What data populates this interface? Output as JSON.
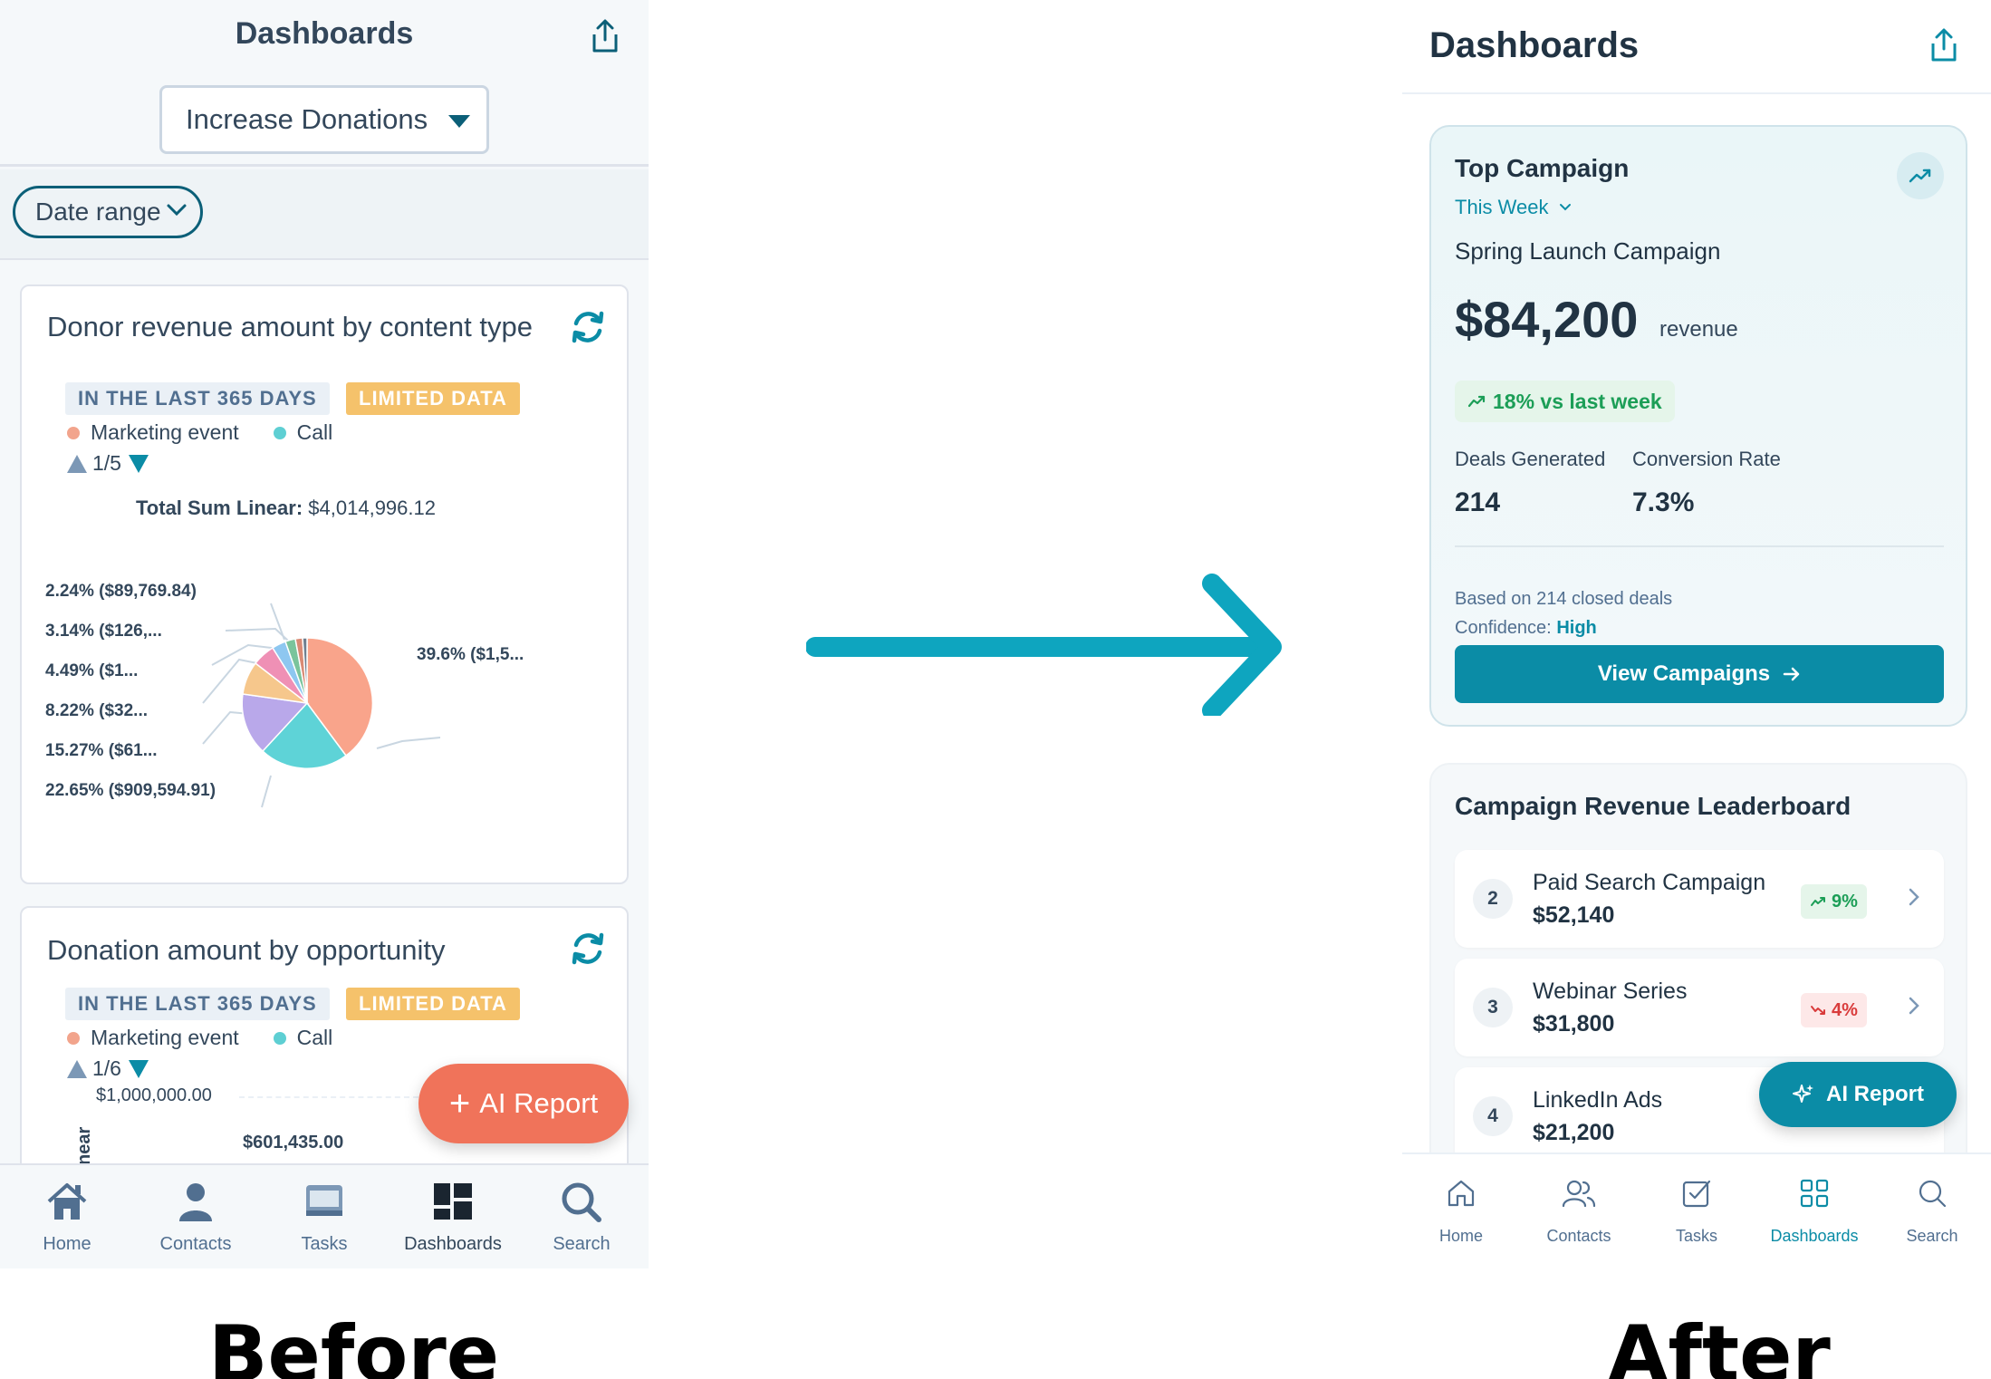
{
  "before": {
    "header": {
      "title": "Dashboards"
    },
    "dashboard_select": {
      "value": "Increase Donations"
    },
    "filters": {
      "date_range_label": "Date range"
    },
    "card1": {
      "title": "Donor revenue amount by content type",
      "tag_range": "IN THE LAST 365 DAYS",
      "tag_limited": "LIMITED DATA",
      "legend": [
        {
          "label": "Marketing event",
          "color": "#f2a48c"
        },
        {
          "label": "Call",
          "color": "#5ecfd3"
        }
      ],
      "pager": "1/5",
      "total_label": "Total Sum Linear:",
      "total_value": "$4,014,996.12",
      "pie_labels": [
        "2.24% ($89,769.84)",
        "3.14% ($126,...",
        "4.49% ($1...",
        "8.22% ($32...",
        "15.27% ($61...",
        "22.65% ($909,594.91)",
        "39.6% ($1,5..."
      ]
    },
    "card2": {
      "title": "Donation amount by opportunity",
      "tag_range": "IN THE LAST 365 DAYS",
      "tag_limited": "LIMITED DATA",
      "legend": [
        {
          "label": "Marketing event",
          "color": "#f2a48c"
        },
        {
          "label": "Call",
          "color": "#5ecfd3"
        }
      ],
      "pager": "1/6",
      "axis_top": "$1,000,000.00",
      "bar_label": "$601,435.00",
      "y_axis_fragment": "near"
    },
    "ai_button": {
      "label": "AI Report"
    },
    "nav": [
      {
        "label": "Home",
        "icon": "home-icon"
      },
      {
        "label": "Contacts",
        "icon": "contacts-icon"
      },
      {
        "label": "Tasks",
        "icon": "tasks-icon"
      },
      {
        "label": "Dashboards",
        "icon": "dashboards-icon"
      },
      {
        "label": "Search",
        "icon": "search-icon"
      }
    ]
  },
  "after": {
    "header": {
      "title": "Dashboards"
    },
    "top_campaign": {
      "title": "Top Campaign",
      "period": "This Week",
      "campaign_name": "Spring Launch Campaign",
      "revenue": "$84,200",
      "revenue_unit": "revenue",
      "delta": "18% vs last week",
      "stats": [
        {
          "label": "Deals Generated",
          "value": "214"
        },
        {
          "label": "Conversion Rate",
          "value": "7.3%"
        }
      ],
      "note": "Based on 214 closed deals",
      "confidence_label": "Confidence:",
      "confidence_value": "High",
      "cta": "View Campaigns"
    },
    "leaderboard": {
      "title": "Campaign Revenue Leaderboard",
      "rows": [
        {
          "rank": "2",
          "name": "Paid Search Campaign",
          "value": "$52,140",
          "change": "9%",
          "direction": "up"
        },
        {
          "rank": "3",
          "name": "Webinar Series",
          "value": "$31,800",
          "change": "4%",
          "direction": "down"
        },
        {
          "rank": "4",
          "name": "LinkedIn Ads",
          "value": "$21,200",
          "change": "",
          "direction": "up"
        }
      ]
    },
    "ai_button": {
      "label": "AI Report"
    },
    "nav": [
      {
        "label": "Home",
        "icon": "home-icon"
      },
      {
        "label": "Contacts",
        "icon": "contacts-icon"
      },
      {
        "label": "Tasks",
        "icon": "tasks-icon"
      },
      {
        "label": "Dashboards",
        "icon": "dashboards-icon",
        "active": true
      },
      {
        "label": "Search",
        "icon": "search-icon"
      }
    ]
  },
  "captions": {
    "before": "Before",
    "after": "After"
  },
  "colors": {
    "accent": "#0b8ca6",
    "before_ai": "#f0735a",
    "limited_tag": "#f5c26b"
  }
}
